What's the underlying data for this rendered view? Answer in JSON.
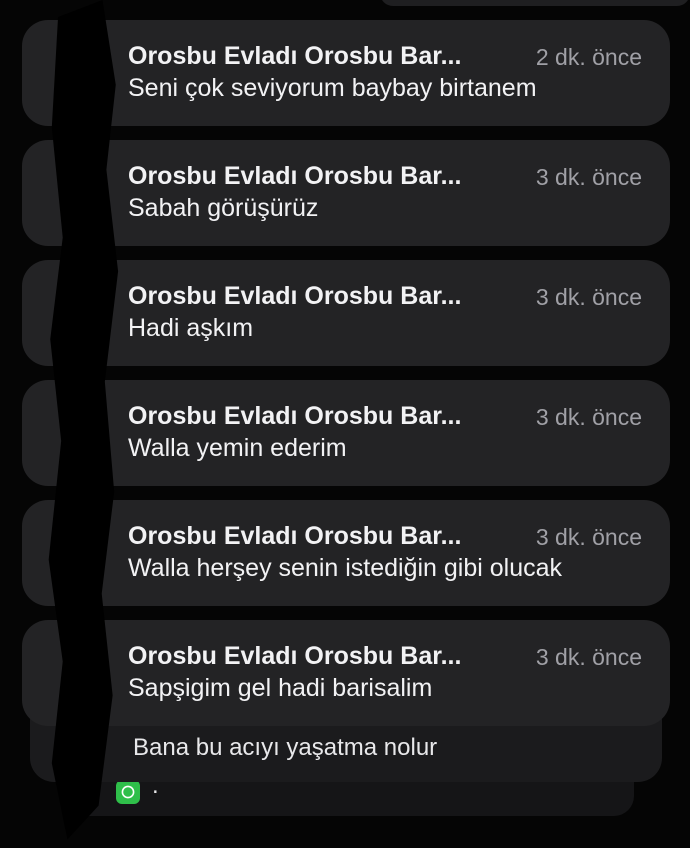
{
  "notifications": [
    {
      "sender": "Orosbu Evladı Orosbu Bar...",
      "time": "2 dk. önce",
      "message": "Seni çok seviyorum baybay birtanem",
      "icon": "whatsapp-icon"
    },
    {
      "sender": "Orosbu Evladı Orosbu Bar...",
      "time": "3 dk. önce",
      "message": "Sabah görüşürüz",
      "icon": "whatsapp-icon"
    },
    {
      "sender": "Orosbu Evladı Orosbu Bar...",
      "time": "3 dk. önce",
      "message": "Hadi aşkım",
      "icon": "whatsapp-icon"
    },
    {
      "sender": "Orosbu Evladı Orosbu Bar...",
      "time": "3 dk. önce",
      "message": "Walla yemin ederim",
      "icon": "whatsapp-icon"
    },
    {
      "sender": "Orosbu Evladı Orosbu Bar...",
      "time": "3 dk. önce",
      "message": "Walla herşey senin istediğin gibi olucak",
      "icon": "whatsapp-icon"
    },
    {
      "sender": "Orosbu Evladı Orosbu Bar...",
      "time": "3 dk. önce",
      "message": "Sapşigim gel hadi barisalim",
      "icon": "whatsapp-icon"
    }
  ],
  "stacked": [
    {
      "message": "Bana bu acıyı yaşatma nolur"
    },
    {
      "message": "."
    }
  ],
  "colors": {
    "background": "#050505",
    "card": "#232325",
    "accent": "#2fbf4a"
  }
}
